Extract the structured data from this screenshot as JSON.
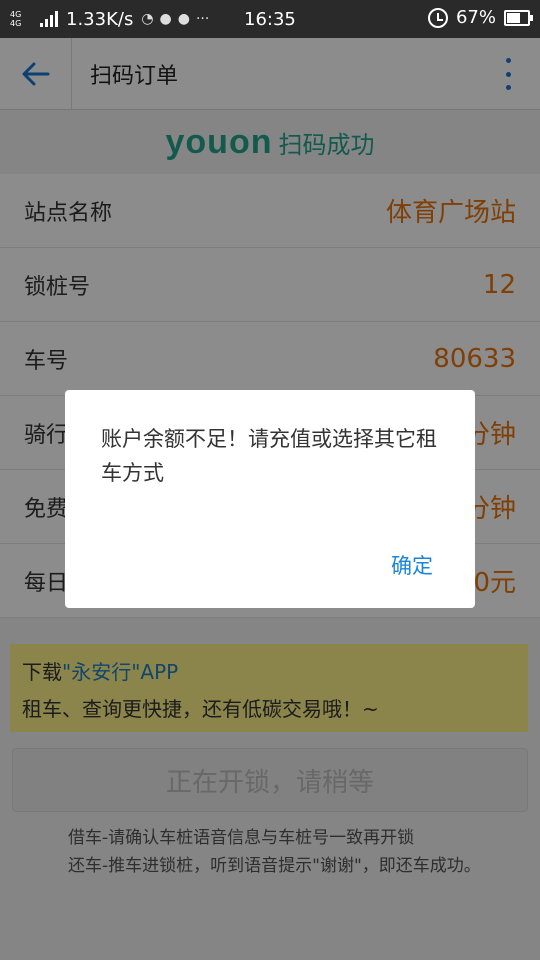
{
  "status_bar": {
    "network": "4G 4G",
    "speed": "1.33K/s",
    "time": "16:35",
    "battery": "67%",
    "battery_level": 0.67
  },
  "header": {
    "title": "扫码订单"
  },
  "logo": {
    "brand": "youon",
    "tagline": "扫码成功",
    "color": "#23a58e"
  },
  "info_rows": [
    {
      "label": "站点名称",
      "value": "体育广场站"
    },
    {
      "label": "锁桩号",
      "value": "12"
    },
    {
      "label": "车号",
      "value": "80633"
    },
    {
      "label": "骑行",
      "value": "分钟"
    },
    {
      "label": "免费",
      "value": "分钟"
    },
    {
      "label": "每日",
      "value": "0元"
    }
  ],
  "promo": {
    "prefix": "下载",
    "app_name": "\"永安行\"APP",
    "line2": "租车、查询更快捷，还有低碳交易哦！~"
  },
  "unlock_button": {
    "label": "正在开锁，请稍等"
  },
  "notes": [
    "借车-请确认车桩语音信息与车桩号一致再开锁",
    "还车-推车进锁桩，听到语音提示\"谢谢\"，即还车成功。"
  ],
  "dialog": {
    "message": "账户余额不足！请充值或选择其它租车方式",
    "confirm_label": "确定"
  },
  "colors": {
    "accent": "#1a86d9",
    "value_orange": "#e8740c",
    "promo_yellow": "#fdf38a"
  }
}
